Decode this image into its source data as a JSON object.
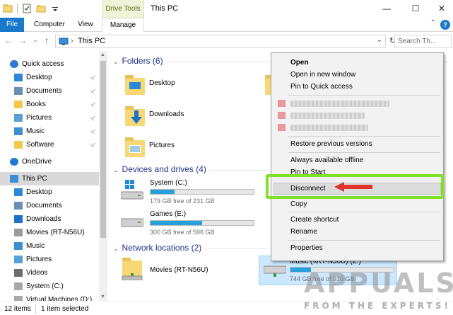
{
  "window": {
    "title": "This PC",
    "context_tab": "Drive Tools",
    "controls": {
      "minimize": "—",
      "maximize": "☐",
      "close": "✕"
    }
  },
  "ribbon": {
    "tabs": [
      "File",
      "Computer",
      "View",
      "Manage"
    ],
    "help": "?",
    "collapse": "⌃"
  },
  "address": {
    "back": "←",
    "forward": "→",
    "recent": "⌄",
    "up": "↑",
    "path_separator": "›",
    "path": "This PC",
    "refresh": "↻",
    "search_placeholder": "Search Th..."
  },
  "navigation": {
    "items": [
      {
        "label": "Quick access",
        "icon": "star-icon",
        "pinned": false
      },
      {
        "label": "Desktop",
        "icon": "desktop-icon",
        "pinned": true
      },
      {
        "label": "Documents",
        "icon": "documents-icon",
        "pinned": true
      },
      {
        "label": "Books",
        "icon": "folder-icon",
        "pinned": true
      },
      {
        "label": "Pictures",
        "icon": "pictures-icon",
        "pinned": true
      },
      {
        "label": "Music",
        "icon": "music-icon",
        "pinned": true
      },
      {
        "label": "Software",
        "icon": "folder-icon",
        "pinned": true
      },
      {
        "label": "OneDrive",
        "icon": "cloud-icon",
        "pinned": false
      },
      {
        "label": "This PC",
        "icon": "computer-icon",
        "pinned": false,
        "selected": true
      },
      {
        "label": "Desktop",
        "icon": "desktop-icon",
        "pinned": false
      },
      {
        "label": "Documents",
        "icon": "documents-icon",
        "pinned": false
      },
      {
        "label": "Downloads",
        "icon": "downloads-icon",
        "pinned": false
      },
      {
        "label": "Movies (RT-N56U)",
        "icon": "network-drive-icon",
        "pinned": false
      },
      {
        "label": "Music",
        "icon": "music-icon",
        "pinned": false
      },
      {
        "label": "Pictures",
        "icon": "pictures-icon",
        "pinned": false
      },
      {
        "label": "Videos",
        "icon": "videos-icon",
        "pinned": false
      },
      {
        "label": "System (C:)",
        "icon": "drive-icon",
        "pinned": false
      },
      {
        "label": "Virtual Machines (D:)",
        "icon": "drive-icon",
        "pinned": false
      }
    ],
    "pin_glyph": "📌"
  },
  "groups": {
    "folders": {
      "title": "Folders (6)",
      "items": [
        "Desktop",
        "Downloads",
        "Pictures"
      ]
    },
    "devices": {
      "title": "Devices and drives (4)",
      "drives": [
        {
          "name": "System (C:)",
          "free": "179 GB free of 231 GB",
          "used_fraction": 0.23
        },
        {
          "name": "Games (E:)",
          "free": "300 GB free of 596 GB",
          "used_fraction": 0.5
        }
      ]
    },
    "network": {
      "title": "Network locations (2)",
      "items": [
        {
          "name": "Movies (RT-N56U)"
        },
        {
          "name": "Music (\\\\RT-N56U) (Z:)",
          "free": "744 GB free of 930 GB",
          "used_fraction": 0.2
        }
      ]
    }
  },
  "context_menu": {
    "items": {
      "open": "Open",
      "open_new_window": "Open in new window",
      "pin_quick_access": "Pin to Quick access",
      "restore_previous": "Restore previous versions",
      "always_offline": "Always available offline",
      "pin_start": "Pin to Start",
      "disconnect": "Disconnect",
      "copy": "Copy",
      "create_shortcut": "Create shortcut",
      "rename": "Rename",
      "properties": "Properties"
    },
    "highlight_color": "#82df2a",
    "arrow_color": "#e0332c"
  },
  "status": {
    "items": "12 items",
    "selected": "1 item selected"
  },
  "watermark": {
    "brand": "APPUALS",
    "tagline": "FROM THE EXPERTS!"
  }
}
